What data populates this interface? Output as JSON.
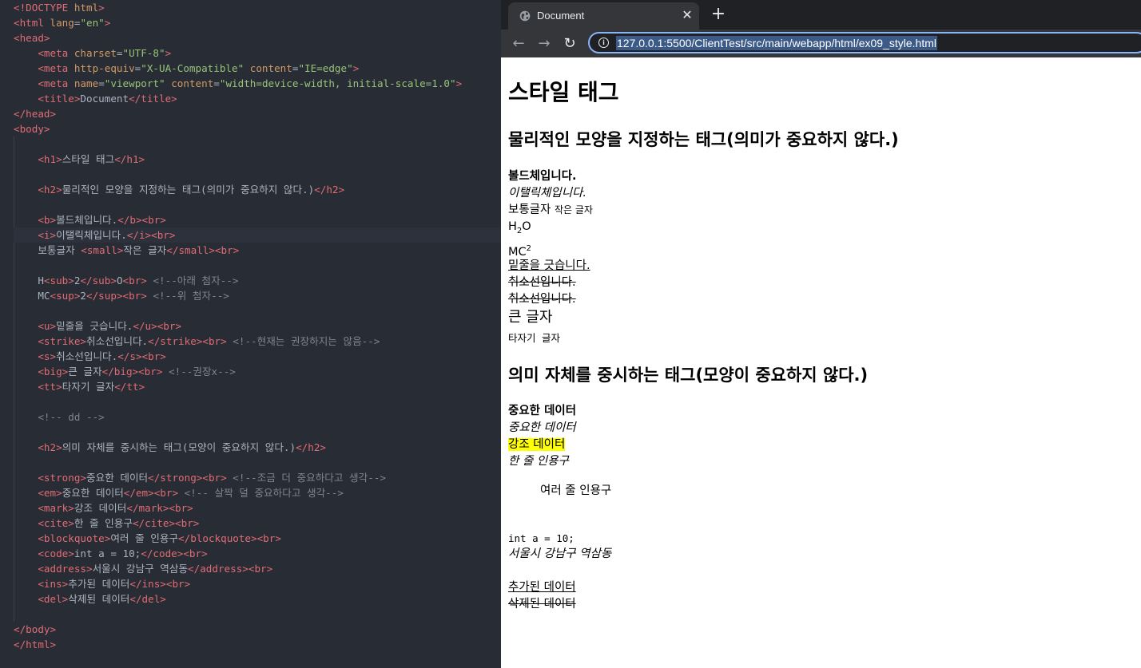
{
  "editor": {
    "lines": [
      {
        "parts": [
          [
            "tg",
            "<!DOCTYPE "
          ],
          [
            "at",
            "html"
          ],
          [
            "tg",
            ">"
          ]
        ]
      },
      {
        "parts": [
          [
            "tg",
            "<html "
          ],
          [
            "at",
            "lang"
          ],
          [
            "tx",
            "="
          ],
          [
            "st",
            "\"en\""
          ],
          [
            "tg",
            ">"
          ]
        ]
      },
      {
        "parts": [
          [
            "tg",
            "<head>"
          ]
        ]
      },
      {
        "parts": [
          [
            "tx",
            "    "
          ],
          [
            "tg",
            "<meta "
          ],
          [
            "at",
            "charset"
          ],
          [
            "tx",
            "="
          ],
          [
            "st",
            "\"UTF-8\""
          ],
          [
            "tg",
            ">"
          ]
        ]
      },
      {
        "parts": [
          [
            "tx",
            "    "
          ],
          [
            "tg",
            "<meta "
          ],
          [
            "at",
            "http-equiv"
          ],
          [
            "tx",
            "="
          ],
          [
            "st",
            "\"X-UA-Compatible\""
          ],
          [
            "tx",
            " "
          ],
          [
            "at",
            "content"
          ],
          [
            "tx",
            "="
          ],
          [
            "st",
            "\"IE=edge\""
          ],
          [
            "tg",
            ">"
          ]
        ]
      },
      {
        "parts": [
          [
            "tx",
            "    "
          ],
          [
            "tg",
            "<meta "
          ],
          [
            "at",
            "name"
          ],
          [
            "tx",
            "="
          ],
          [
            "st",
            "\"viewport\""
          ],
          [
            "tx",
            " "
          ],
          [
            "at",
            "content"
          ],
          [
            "tx",
            "="
          ],
          [
            "st",
            "\"width=device-width, initial-scale=1.0\""
          ],
          [
            "tg",
            ">"
          ]
        ]
      },
      {
        "parts": [
          [
            "tx",
            "    "
          ],
          [
            "tg",
            "<title>"
          ],
          [
            "tx",
            "Document"
          ],
          [
            "tg",
            "</title>"
          ]
        ]
      },
      {
        "parts": [
          [
            "tg",
            "</head>"
          ]
        ]
      },
      {
        "parts": [
          [
            "tg",
            "<body>"
          ]
        ]
      },
      {
        "parts": []
      },
      {
        "parts": [
          [
            "tx",
            "    "
          ],
          [
            "tg",
            "<h1>"
          ],
          [
            "tx",
            "스타일 태그"
          ],
          [
            "tg",
            "</h1>"
          ]
        ]
      },
      {
        "parts": []
      },
      {
        "parts": [
          [
            "tx",
            "    "
          ],
          [
            "tg",
            "<h2>"
          ],
          [
            "tx",
            "물리적인 모양을 지정하는 태그(의미가 중요하지 않다.)"
          ],
          [
            "tg",
            "</h2>"
          ]
        ]
      },
      {
        "parts": []
      },
      {
        "parts": [
          [
            "tx",
            "    "
          ],
          [
            "tg",
            "<b>"
          ],
          [
            "tx",
            "볼드체입니다."
          ],
          [
            "tg",
            "</b><br>"
          ]
        ]
      },
      {
        "parts": [
          [
            "tx",
            "    "
          ],
          [
            "tg",
            "<i>"
          ],
          [
            "tx",
            "이탤릭체입니다."
          ],
          [
            "tg",
            "</i><br>"
          ]
        ],
        "active": true
      },
      {
        "parts": [
          [
            "tx",
            "    보통글자 "
          ],
          [
            "tg",
            "<small>"
          ],
          [
            "tx",
            "작은 글자"
          ],
          [
            "tg",
            "</small><br>"
          ]
        ]
      },
      {
        "parts": []
      },
      {
        "parts": [
          [
            "tx",
            "    H"
          ],
          [
            "tg",
            "<sub>"
          ],
          [
            "tx",
            "2"
          ],
          [
            "tg",
            "</sub>"
          ],
          [
            "tx",
            "O"
          ],
          [
            "tg",
            "<br>"
          ],
          [
            "tx",
            " "
          ],
          [
            "cm",
            "<!--아래 첨자-->"
          ]
        ]
      },
      {
        "parts": [
          [
            "tx",
            "    MC"
          ],
          [
            "tg",
            "<sup>"
          ],
          [
            "tx",
            "2"
          ],
          [
            "tg",
            "</sup><br>"
          ],
          [
            "tx",
            " "
          ],
          [
            "cm",
            "<!--위 첨자-->"
          ]
        ]
      },
      {
        "parts": []
      },
      {
        "parts": [
          [
            "tx",
            "    "
          ],
          [
            "tg",
            "<u>"
          ],
          [
            "tx",
            "밑줄을 긋습니다."
          ],
          [
            "tg",
            "</u><br>"
          ]
        ]
      },
      {
        "parts": [
          [
            "tx",
            "    "
          ],
          [
            "tg",
            "<strike>"
          ],
          [
            "tx",
            "취소선입니다."
          ],
          [
            "tg",
            "</strike><br>"
          ],
          [
            "tx",
            " "
          ],
          [
            "cm",
            "<!--현재는 권장하지는 않음-->"
          ]
        ]
      },
      {
        "parts": [
          [
            "tx",
            "    "
          ],
          [
            "tg",
            "<s>"
          ],
          [
            "tx",
            "취소선입니다."
          ],
          [
            "tg",
            "</s><br>"
          ]
        ]
      },
      {
        "parts": [
          [
            "tx",
            "    "
          ],
          [
            "tg",
            "<big>"
          ],
          [
            "tx",
            "큰 글자"
          ],
          [
            "tg",
            "</big><br>"
          ],
          [
            "tx",
            " "
          ],
          [
            "cm",
            "<!--권장x-->"
          ]
        ]
      },
      {
        "parts": [
          [
            "tx",
            "    "
          ],
          [
            "tg",
            "<tt>"
          ],
          [
            "tx",
            "타자기 글자"
          ],
          [
            "tg",
            "</tt>"
          ]
        ]
      },
      {
        "parts": []
      },
      {
        "parts": [
          [
            "tx",
            "    "
          ],
          [
            "cm",
            "<!-- dd -->"
          ]
        ]
      },
      {
        "parts": []
      },
      {
        "parts": [
          [
            "tx",
            "    "
          ],
          [
            "tg",
            "<h2>"
          ],
          [
            "tx",
            "의미 자체를 중시하는 태그(모양이 중요하지 않다.)"
          ],
          [
            "tg",
            "</h2>"
          ]
        ]
      },
      {
        "parts": []
      },
      {
        "parts": [
          [
            "tx",
            "    "
          ],
          [
            "tg",
            "<strong>"
          ],
          [
            "tx",
            "중요한 데이터"
          ],
          [
            "tg",
            "</strong><br>"
          ],
          [
            "tx",
            " "
          ],
          [
            "cm",
            "<!--조금 더 중요하다고 생각-->"
          ]
        ]
      },
      {
        "parts": [
          [
            "tx",
            "    "
          ],
          [
            "tg",
            "<em>"
          ],
          [
            "tx",
            "중요한 데이터"
          ],
          [
            "tg",
            "</em><br>"
          ],
          [
            "tx",
            " "
          ],
          [
            "cm",
            "<!-- 살짝 덜 중요하다고 생각-->"
          ]
        ]
      },
      {
        "parts": [
          [
            "tx",
            "    "
          ],
          [
            "tg",
            "<mark>"
          ],
          [
            "tx",
            "강조 데이터"
          ],
          [
            "tg",
            "</mark><br>"
          ]
        ]
      },
      {
        "parts": [
          [
            "tx",
            "    "
          ],
          [
            "tg",
            "<cite>"
          ],
          [
            "tx",
            "한 줄 인용구"
          ],
          [
            "tg",
            "</cite><br>"
          ]
        ]
      },
      {
        "parts": [
          [
            "tx",
            "    "
          ],
          [
            "tg",
            "<blockquote>"
          ],
          [
            "tx",
            "여러 줄 인용구"
          ],
          [
            "tg",
            "</blockquote><br>"
          ]
        ]
      },
      {
        "parts": [
          [
            "tx",
            "    "
          ],
          [
            "tg",
            "<code>"
          ],
          [
            "tx",
            "int a = 10;"
          ],
          [
            "tg",
            "</code><br>"
          ]
        ]
      },
      {
        "parts": [
          [
            "tx",
            "    "
          ],
          [
            "tg",
            "<address>"
          ],
          [
            "tx",
            "서울시 강남구 역삼동"
          ],
          [
            "tg",
            "</address><br>"
          ]
        ]
      },
      {
        "parts": [
          [
            "tx",
            "    "
          ],
          [
            "tg",
            "<ins>"
          ],
          [
            "tx",
            "추가된 데이터"
          ],
          [
            "tg",
            "</ins><br>"
          ]
        ]
      },
      {
        "parts": [
          [
            "tx",
            "    "
          ],
          [
            "tg",
            "<del>"
          ],
          [
            "tx",
            "삭제된 데이터"
          ],
          [
            "tg",
            "</del>"
          ]
        ]
      },
      {
        "parts": []
      },
      {
        "parts": [
          [
            "tg",
            "</body>"
          ]
        ]
      },
      {
        "parts": [
          [
            "tg",
            "</html>"
          ]
        ]
      }
    ]
  },
  "browser": {
    "tab_title": "Document",
    "tab_close": "✕",
    "new_tab": "+",
    "back": "←",
    "forward": "→",
    "reload": "↻",
    "info": "i",
    "url": "127.0.0.1:5500/ClientTest/src/main/webapp/html/ex09_style.html"
  },
  "page": {
    "h1": "스타일 태그",
    "h2_physical": "물리적인 모양을 지정하는 태그(의미가 중요하지 않다.)",
    "bold": "볼드체입니다.",
    "italic": "이탤릭체입니다.",
    "normal": "보통글자 ",
    "small": "작은 글자",
    "sub_base": "H",
    "sub_val": "2",
    "sub_tail": "O",
    "sup_base": "MC",
    "sup_val": "2",
    "underline": "밑줄을 긋습니다.",
    "strike": "취소선입니다.",
    "s": "취소선입니다.",
    "big": "큰 글자",
    "tt": "타자기 글자",
    "h2_semantic": "의미 자체를 중시하는 태그(모양이 중요하지 않다.)",
    "strong": "중요한 데이터",
    "em": "중요한 데이터",
    "mark": "강조 데이터",
    "cite": "한 줄 인용구",
    "blockquote": "여러 줄 인용구",
    "code": "int a = 10;",
    "address": "서울시 강남구 역삼동",
    "ins": "추가된 데이터",
    "del": "삭제된 데이터"
  }
}
